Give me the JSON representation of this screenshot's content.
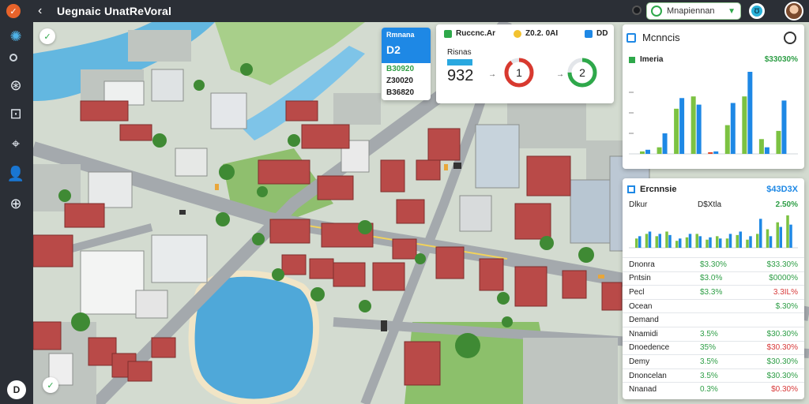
{
  "app": {
    "title": "Uegnaic UnatReVoral",
    "logo_glyph": "✓"
  },
  "topbar": {
    "search_label": "Mnapiennan",
    "circle_glyph": "Ʊ"
  },
  "sidebar": {
    "bottom_label": "D"
  },
  "map": {
    "button_top_glyph": "✓",
    "button_bottom_glyph": "✓"
  },
  "kpi_card": {
    "title": "Rmnana",
    "value": "D2",
    "rows": [
      "B30920",
      "Z30020",
      "B36820"
    ],
    "accent": "#1e88e5"
  },
  "gauge_card": {
    "label_1": "Ruccnc.Ar",
    "label_2": "Z0.2. 0AI",
    "label_3": "DD",
    "sub_label": "Risnas",
    "big_number": "932",
    "gauge_1": {
      "value": "1",
      "fraction": 0.9
    },
    "gauge_2": {
      "value": "2",
      "fraction": 0.75
    }
  },
  "metrics_card": {
    "title": "Mcnncis",
    "sub_label": "Imeria",
    "sub_value": "$33030%",
    "chart_data": {
      "type": "bar",
      "series": [
        {
          "name": "green",
          "values": [
            3,
            8,
            55,
            70,
            2,
            35,
            70,
            18,
            28
          ]
        },
        {
          "name": "blue",
          "values": [
            5,
            25,
            68,
            60,
            3,
            62,
            100,
            8,
            65
          ]
        }
      ],
      "colors": {
        "green": "#7cc242",
        "blue": "#1e88e5",
        "red": "#e0492e"
      }
    }
  },
  "table_card": {
    "title": "Ercnnsie",
    "total": "$43D3X",
    "sub_1": "Dlkur",
    "sub_2": "D$Xtla",
    "sub_3": "2.50%",
    "chart_data": {
      "type": "bar",
      "series": [
        {
          "name": "green",
          "values": [
            8,
            12,
            10,
            14,
            6,
            9,
            12,
            7,
            10,
            8,
            11,
            7,
            12,
            16,
            22,
            28
          ]
        },
        {
          "name": "blue",
          "values": [
            10,
            14,
            12,
            11,
            8,
            12,
            10,
            9,
            8,
            12,
            14,
            10,
            25,
            10,
            18,
            20
          ]
        }
      ]
    },
    "rows": [
      {
        "name": "Dnonra",
        "col2": "$3.30%",
        "col3": "$33.30%",
        "col3_red": false
      },
      {
        "name": "Pntsin",
        "col2": "$3.0%",
        "col3": "$0000%",
        "col3_red": false
      },
      {
        "name": "Pecl",
        "col2": "$3.3%",
        "col3": "3.3IL%",
        "col3_red": true
      },
      {
        "name": "Ocean",
        "col2": "",
        "col3": "$.30%",
        "col3_red": false
      },
      {
        "name": "Demand",
        "col2": "",
        "col3": "",
        "col3_red": false
      },
      {
        "name": "Nnamidi",
        "col2": "3.5%",
        "col3": "$30.30%",
        "col3_red": false
      },
      {
        "name": "Dnoedence",
        "col2": "35%",
        "col3": "$30.30%",
        "col3_red": true
      },
      {
        "name": "Demy",
        "col2": "3.5%",
        "col3": "$30.30%",
        "col3_red": false
      },
      {
        "name": "Dnoncelan",
        "col2": "3.5%",
        "col3": "$30.30%",
        "col3_red": false
      },
      {
        "name": "Nnanad",
        "col2": "0.3%",
        "col3": "$0.30%",
        "col3_red": true
      }
    ]
  }
}
